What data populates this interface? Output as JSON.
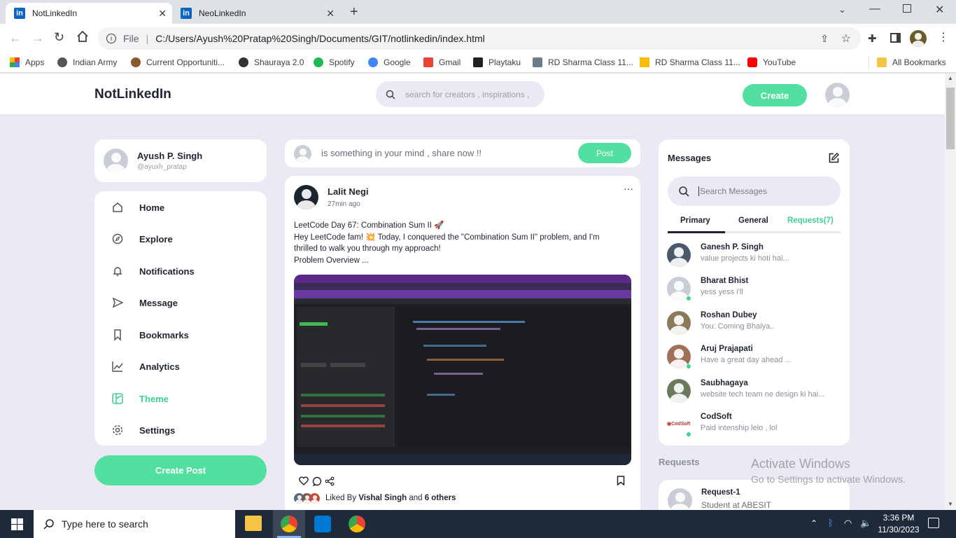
{
  "browser": {
    "tabs": [
      {
        "label": "NotLinkedIn",
        "icon": "linkedin-icon"
      },
      {
        "label": "NeoLinkedIn",
        "icon": "linkedin-icon"
      }
    ],
    "address_prefix": "File",
    "url": "C:/Users/Ayush%20Pratap%20Singh/Documents/GIT/notlinkedin/index.html",
    "bookmarks": [
      {
        "label": "Apps",
        "icon": "apps-grid-icon",
        "color": "#ea4335"
      },
      {
        "label": "Indian Army",
        "icon": "army-icon",
        "color": "#555555"
      },
      {
        "label": "Current Opportuniti...",
        "icon": "emblem-icon",
        "color": "#8a5a2b"
      },
      {
        "label": "Shauraya 2.0",
        "icon": "wordpress-icon",
        "color": "#333333"
      },
      {
        "label": "Spotify",
        "icon": "spotify-icon",
        "color": "#1db954"
      },
      {
        "label": "Google",
        "icon": "google-icon",
        "color": "#4285f4"
      },
      {
        "label": "Gmail",
        "icon": "gmail-icon",
        "color": "#ea4335"
      },
      {
        "label": "Playtaku",
        "icon": "playtaku-icon",
        "color": "#222222"
      },
      {
        "label": "RD Sharma Class 11...",
        "icon": "school-icon",
        "color": "#6a7b8c"
      },
      {
        "label": "RD Sharma Class 11...",
        "icon": "drive-icon",
        "color": "#fbbc04"
      },
      {
        "label": "YouTube",
        "icon": "youtube-icon",
        "color": "#ff0000"
      }
    ],
    "all_bookmarks": "All Bookmarks"
  },
  "app": {
    "logo": "NotLinkedIn",
    "search_placeholder": "search for creators , inspirations ,",
    "create_label": "Create",
    "accent": "#52e0a0"
  },
  "profile": {
    "name": "Ayush P. Singh",
    "handle": "@ayuxh_pratap"
  },
  "menu": [
    {
      "label": "Home",
      "icon": "home-icon",
      "active": false
    },
    {
      "label": "Explore",
      "icon": "compass-icon",
      "active": false
    },
    {
      "label": "Notifications",
      "icon": "bell-icon",
      "active": false
    },
    {
      "label": "Message",
      "icon": "send-icon",
      "active": false
    },
    {
      "label": "Bookmarks",
      "icon": "bookmark-icon",
      "active": false
    },
    {
      "label": "Analytics",
      "icon": "chart-icon",
      "active": false
    },
    {
      "label": "Theme",
      "icon": "palette-icon",
      "active": true
    },
    {
      "label": "Settings",
      "icon": "gear-icon",
      "active": false
    }
  ],
  "create_post_label": "Create Post",
  "composer": {
    "placeholder": "is something in your mind , share now !!",
    "post_label": "Post"
  },
  "post": {
    "author": "Lalit Negi",
    "time": "27min ago",
    "line1": "LeetCode Day 67: Combination Sum II 🚀",
    "line2": "Hey LeetCode fam! 💥 Today, I conquered the \"Combination Sum II\" problem, and I'm",
    "line3": "thrilled to walk you through my approach!",
    "line4": "Problem Overview ...",
    "liked_prefix": "Liked By",
    "liked_name": "Vishal Singh",
    "liked_and": "and",
    "liked_others": "6 others"
  },
  "messages": {
    "title": "Messages",
    "search_placeholder": "Search Messages",
    "tabs": [
      "Primary",
      "General",
      "Requests(7)"
    ],
    "items": [
      {
        "name": "Ganesh P. Singh",
        "text": "value projects ki hoti hai..."
      },
      {
        "name": "Bharat Bhist",
        "text": "yess yess i'll"
      },
      {
        "name": "Roshan Dubey",
        "text": "You: Coming Bhaiya.."
      },
      {
        "name": "Aruj Prajapati",
        "text": "Have a great day ahead ..."
      },
      {
        "name": "Saubhagaya",
        "text": "website tech team ne design ki hai..."
      },
      {
        "name": "CodSoft",
        "text": "Paid intenship lelo , lol"
      }
    ]
  },
  "requests": {
    "title": "Requests",
    "item": {
      "name": "Request-1",
      "text": "Student at ABESIT"
    }
  },
  "watermark": {
    "line1": "Activate Windows",
    "line2": "Go to Settings to activate Windows."
  },
  "taskbar": {
    "search_placeholder": "Type here to search",
    "time": "3:36 PM",
    "date": "11/30/2023"
  }
}
